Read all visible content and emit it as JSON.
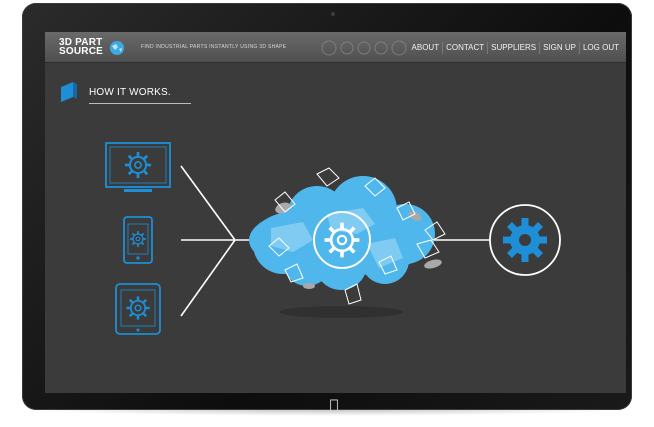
{
  "brand": {
    "logo_line1": "3D PART",
    "logo_line2": "SOURCE",
    "tagline": "FIND INDUSTRIAL PARTS INSTANTLY USING 3D SHAPE"
  },
  "nav": {
    "items": [
      {
        "label": "ABOUT"
      },
      {
        "label": "CONTACT"
      },
      {
        "label": "SUPPLIERS"
      },
      {
        "label": "SIGN UP"
      },
      {
        "label": "LOG OUT"
      }
    ]
  },
  "section": {
    "title": "HOW IT WORKS."
  },
  "colors": {
    "accent_blue": "#1e8fd6",
    "cloud_blue": "#4fb7ec",
    "screen_bg": "#3b3b3b",
    "navbar": "#5c5c5c",
    "line": "#ffffff"
  },
  "icons": {
    "brand_mark": "globe-icon",
    "section_marker": "cube-icon",
    "devices": [
      "monitor-gear-icon",
      "phone-gear-icon",
      "tablet-gear-icon"
    ],
    "cloud": "cloud-gear-icon",
    "output": "gear-icon",
    "apple": "apple-logo-icon"
  }
}
